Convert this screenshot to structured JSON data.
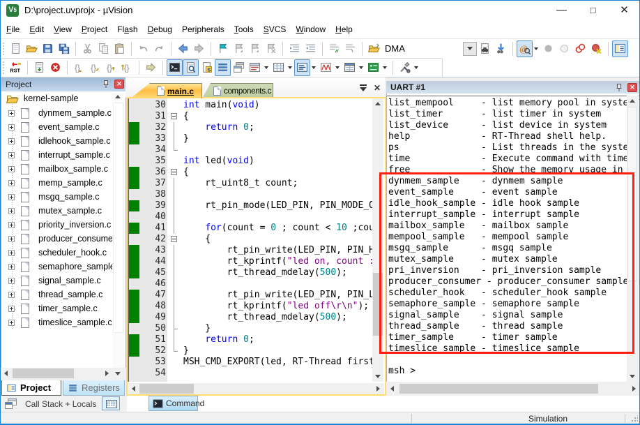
{
  "window": {
    "title": "D:\\project.uvprojx - µVision"
  },
  "menu": {
    "items": [
      [
        "File",
        0
      ],
      [
        "Edit",
        0
      ],
      [
        "View",
        0
      ],
      [
        "Project",
        0
      ],
      [
        "Flash",
        2
      ],
      [
        "Debug",
        0
      ],
      [
        "Peripherals",
        3
      ],
      [
        "Tools",
        0
      ],
      [
        "SVCS",
        0
      ],
      [
        "Window",
        0
      ],
      [
        "Help",
        0
      ]
    ]
  },
  "toolbars": {
    "row1": [
      [
        "new-file",
        ""
      ],
      [
        "open",
        ""
      ],
      [
        "save",
        ""
      ],
      [
        "save-all",
        ""
      ],
      "|",
      [
        "cut",
        ""
      ],
      [
        "copy",
        ""
      ],
      [
        "paste",
        ""
      ],
      "|",
      [
        "undo",
        ""
      ],
      [
        "redo",
        ""
      ],
      "|",
      [
        "navigate-back",
        ""
      ],
      [
        "navigate-forward",
        ""
      ],
      "|",
      [
        "bookmark-toggle",
        ""
      ],
      [
        "bookmark-prev",
        ""
      ],
      [
        "bookmark-next",
        ""
      ],
      [
        "bookmark-clear",
        ""
      ],
      "|",
      [
        "indent",
        ""
      ],
      [
        "outdent",
        ""
      ],
      "|",
      [
        "comment",
        ""
      ],
      [
        "uncomment",
        ""
      ],
      "|",
      [
        "open-project-folder",
        ""
      ],
      "combo",
      [
        "find-in-files",
        ""
      ],
      [
        "incremental-find",
        ""
      ],
      "|",
      [
        "find-symbol",
        "bd"
      ],
      [
        "bp-toggle",
        ""
      ],
      [
        "bp-enable",
        ""
      ],
      [
        "bp-disable",
        ""
      ],
      [
        "bp-kill",
        ""
      ],
      "|",
      [
        "manage-layout",
        "b"
      ]
    ],
    "row2": [
      [
        "reset-cpu",
        ""
      ],
      "|",
      [
        "run",
        ""
      ],
      [
        "stop",
        ""
      ],
      "|",
      [
        "step",
        ""
      ],
      [
        "step-over",
        ""
      ],
      [
        "step-out",
        ""
      ],
      [
        "run-to-cursor",
        ""
      ],
      "|",
      [
        "show-next-statement",
        ""
      ],
      "|",
      [
        "command-window",
        "b"
      ],
      [
        "disassembly-window",
        "b"
      ],
      [
        "symbols-window",
        ""
      ],
      [
        "registers-window",
        "b"
      ],
      [
        "call-stack-window",
        ""
      ],
      [
        "watch-windows",
        "d"
      ],
      [
        "memory-windows",
        "d"
      ],
      [
        "serial-windows",
        "bd"
      ],
      [
        "analysis-windows",
        "d"
      ],
      [
        "system-viewer",
        "d"
      ],
      [
        "debug-restore-views",
        "d"
      ],
      "|",
      [
        "toolbox",
        "d"
      ]
    ],
    "combo_value": "DMA"
  },
  "project": {
    "header": "Project",
    "root": "kernel-sample",
    "files": [
      "dynmem_sample.c",
      "event_sample.c",
      "idlehook_sample.c",
      "interrupt_sample.c",
      "mailbox_sample.c",
      "memp_sample.c",
      "msgq_sample.c",
      "mutex_sample.c",
      "priority_inversion.c",
      "producer_consumer.c",
      "scheduler_hook.c",
      "semaphore_sample.c",
      "signal_sample.c",
      "thread_sample.c",
      "timer_sample.c",
      "timeslice_sample.c"
    ],
    "tabs": [
      {
        "label": "Project"
      },
      {
        "label": "Registers"
      }
    ]
  },
  "editor": {
    "tabs": [
      {
        "label": "main.c",
        "active": true
      },
      {
        "label": "components.c",
        "active": false
      }
    ],
    "green_lines": [
      32,
      33,
      36,
      37,
      39,
      41,
      43,
      44,
      45,
      47,
      48,
      49,
      51,
      52
    ],
    "folds": {
      "31": "box",
      "32": "v",
      "33": "v",
      "34": "end",
      "36": "box",
      "37": "v",
      "38": "v",
      "39": "v",
      "40": "v",
      "41": "v",
      "42": "box",
      "43": "v",
      "44": "v",
      "45": "v",
      "46": "v",
      "47": "v",
      "48": "v",
      "49": "v",
      "50": "mid",
      "51": "v",
      "52": "end"
    },
    "lines": [
      [
        30,
        [
          [
            "int",
            "k"
          ],
          [
            " main(",
            ""
          ],
          [
            "void",
            "k"
          ],
          [
            ")",
            ""
          ]
        ]
      ],
      [
        31,
        [
          [
            "{",
            ""
          ]
        ]
      ],
      [
        32,
        [
          [
            "    ",
            ""
          ],
          [
            "return",
            "k"
          ],
          [
            " ",
            ""
          ],
          [
            "0",
            "n"
          ],
          [
            ";",
            ""
          ]
        ]
      ],
      [
        33,
        [
          [
            "}",
            ""
          ]
        ]
      ],
      [
        34,
        []
      ],
      [
        35,
        [
          [
            "int",
            "k"
          ],
          [
            " led(",
            ""
          ],
          [
            "void",
            "k"
          ],
          [
            ")",
            ""
          ]
        ]
      ],
      [
        36,
        [
          [
            "{",
            ""
          ]
        ]
      ],
      [
        37,
        [
          [
            "    rt_uint8_t count;",
            ""
          ]
        ]
      ],
      [
        38,
        []
      ],
      [
        39,
        [
          [
            "    rt_pin_mode(LED_PIN, PIN_MODE_OUTPUT);",
            ""
          ]
        ]
      ],
      [
        40,
        []
      ],
      [
        41,
        [
          [
            "    ",
            ""
          ],
          [
            "for",
            "k"
          ],
          [
            "(count = ",
            ""
          ],
          [
            "0",
            "n"
          ],
          [
            " ; count < ",
            ""
          ],
          [
            "10",
            "n"
          ],
          [
            " ;count++)",
            ""
          ]
        ]
      ],
      [
        42,
        [
          [
            "    {",
            ""
          ]
        ]
      ],
      [
        43,
        [
          [
            "        rt_pin_write(LED_PIN, PIN_HIGH);",
            ""
          ]
        ]
      ],
      [
        44,
        [
          [
            "        rt_kprintf(",
            ""
          ],
          [
            "\"led on, count : %d\\r\\n\"",
            "s"
          ],
          [
            ", count);",
            ""
          ]
        ]
      ],
      [
        45,
        [
          [
            "        rt_thread_mdelay(",
            ""
          ],
          [
            "500",
            "n"
          ],
          [
            ");",
            ""
          ]
        ]
      ],
      [
        46,
        []
      ],
      [
        47,
        [
          [
            "        rt_pin_write(LED_PIN, PIN_LOW);",
            ""
          ]
        ]
      ],
      [
        48,
        [
          [
            "        rt_kprintf(",
            ""
          ],
          [
            "\"led off\\r\\n\"",
            "s"
          ],
          [
            ");",
            ""
          ]
        ]
      ],
      [
        49,
        [
          [
            "        rt_thread_mdelay(",
            ""
          ],
          [
            "500",
            "n"
          ],
          [
            ");",
            ""
          ]
        ]
      ],
      [
        50,
        [
          [
            "    }",
            ""
          ]
        ]
      ],
      [
        51,
        [
          [
            "    ",
            ""
          ],
          [
            "return",
            "k"
          ],
          [
            " ",
            ""
          ],
          [
            "0",
            "n"
          ],
          [
            ";",
            ""
          ]
        ]
      ],
      [
        52,
        [
          [
            "}",
            ""
          ]
        ]
      ],
      [
        53,
        [
          [
            "MSH_CMD_EXPORT(led, RT-Thread first led sample);",
            ""
          ]
        ]
      ],
      [
        54,
        []
      ]
    ]
  },
  "uart": {
    "header": "UART #1",
    "commands": [
      [
        "list_mempool",
        "list memory pool in system"
      ],
      [
        "list_timer",
        "list timer in system"
      ],
      [
        "list_device",
        "list device in system"
      ],
      [
        "help",
        "RT-Thread shell help."
      ],
      [
        "ps",
        "List threads in the system."
      ],
      [
        "time",
        "Execute command with time."
      ],
      [
        "free",
        "Show the memory usage in the system."
      ],
      [
        "dynmem_sample",
        "dynmem sample"
      ],
      [
        "event_sample",
        "event sample"
      ],
      [
        "idle_hook_sample",
        "idle hook sample"
      ],
      [
        "interrupt_sample",
        "interrupt sample"
      ],
      [
        "mailbox_sample",
        "mailbox sample"
      ],
      [
        "mempool_sample",
        "mempool sample"
      ],
      [
        "msgq_sample",
        "msgq sample"
      ],
      [
        "mutex_sample",
        "mutex sample"
      ],
      [
        "pri_inversion",
        "pri_inversion sample"
      ],
      [
        "producer_consumer",
        "producer_consumer sample"
      ],
      [
        "scheduler_hook",
        "scheduler_hook sample"
      ],
      [
        "semaphore_sample",
        "semaphore sample"
      ],
      [
        "signal_sample",
        "signal sample"
      ],
      [
        "thread_sample",
        "thread sample"
      ],
      [
        "timer_sample",
        "timer sample"
      ],
      [
        "timeslice_sample",
        "timeslice sample"
      ]
    ],
    "prompt": "msh >"
  },
  "panels": {
    "call_stack": "Call Stack + Locals",
    "command": "Command"
  },
  "statusbar": {
    "mode": "Simulation"
  },
  "annotation": {
    "color": "#ff1e10"
  }
}
